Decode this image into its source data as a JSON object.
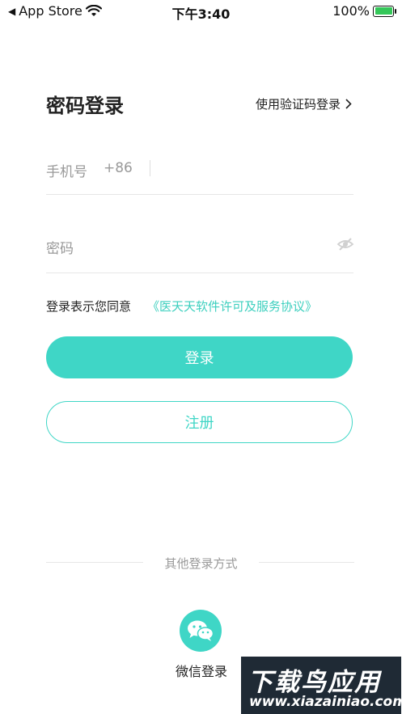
{
  "status_bar": {
    "back_app": "App Store",
    "time": "下午3:40",
    "battery": "100%"
  },
  "header": {
    "title": "密码登录",
    "switch_link": "使用验证码登录"
  },
  "phone_field": {
    "label": "手机号",
    "country_code": "+86",
    "value": ""
  },
  "password_field": {
    "label": "密码",
    "value": ""
  },
  "agreement": {
    "text": "登录表示您同意",
    "link": "《医天天软件许可及服务协议》"
  },
  "buttons": {
    "login": "登录",
    "register": "注册"
  },
  "other_login": {
    "title": "其他登录方式",
    "wechat_label": "微信登录"
  },
  "watermark": {
    "title": "下载鸟应用",
    "url": "www.xiazainiao.com"
  },
  "colors": {
    "accent": "#3fd6c6",
    "link": "#3ccfbe",
    "muted": "#999999"
  }
}
